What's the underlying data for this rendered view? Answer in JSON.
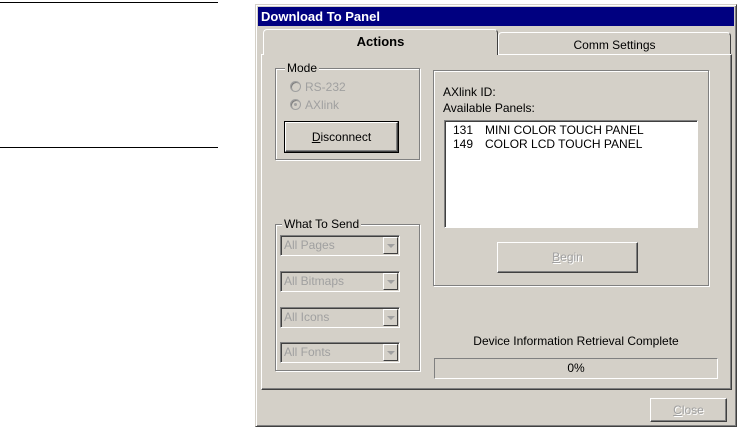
{
  "window": {
    "title": "Download To Panel"
  },
  "tabs": [
    {
      "label": "Actions",
      "active": true
    },
    {
      "label": "Comm Settings",
      "active": false
    }
  ],
  "mode": {
    "legend": "Mode",
    "options": [
      {
        "label": "RS-232",
        "selected": false,
        "enabled": false
      },
      {
        "label": "AXlink",
        "selected": true,
        "enabled": false
      }
    ],
    "disconnect_label": "Disconnect",
    "disconnect_accel": "D",
    "disconnect_rest": "isconnect"
  },
  "what_to_send": {
    "legend": "What To Send",
    "combos": [
      {
        "value": "All Pages"
      },
      {
        "value": "All Bitmaps"
      },
      {
        "value": "All Icons"
      },
      {
        "value": "All Fonts"
      }
    ]
  },
  "panels": {
    "axlink_id_label": "AXlink ID:",
    "available_label": "Available Panels:",
    "items": [
      {
        "id": "131",
        "name": "MINI COLOR TOUCH PANEL"
      },
      {
        "id": "149",
        "name": "COLOR LCD TOUCH PANEL"
      }
    ],
    "begin_label": "Begin",
    "begin_accel": "B",
    "begin_rest": "egin"
  },
  "status": {
    "message": "Device Information Retrieval Complete",
    "progress_text": "0%",
    "progress_value": 0
  },
  "footer": {
    "close_label": "Close",
    "close_accel": "C",
    "close_rest": "lose"
  },
  "colors": {
    "titlebar": "#000080",
    "face": "#d4d0c8",
    "disabled_text": "#a0a0a0"
  }
}
